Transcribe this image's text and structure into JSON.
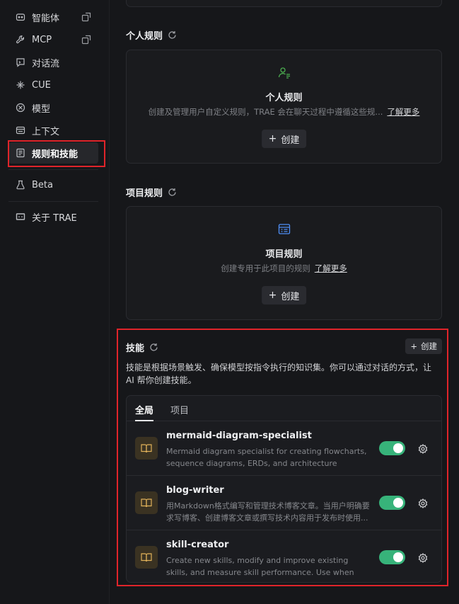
{
  "sidebar": {
    "items": [
      {
        "label": "智能体",
        "icon": "agent-icon",
        "external": true
      },
      {
        "label": "MCP",
        "icon": "wrench-icon",
        "external": true
      },
      {
        "label": "对话流",
        "icon": "chat-flow-icon"
      },
      {
        "label": "CUE",
        "icon": "cue-icon"
      },
      {
        "label": "模型",
        "icon": "model-icon"
      },
      {
        "label": "上下文",
        "icon": "context-icon"
      },
      {
        "label": "规则和技能",
        "icon": "rules-icon",
        "active": true
      }
    ],
    "beta": {
      "label": "Beta",
      "icon": "flask-icon"
    },
    "about": {
      "label": "关于 TRAE",
      "icon": "trae-logo-icon"
    }
  },
  "personal_rules": {
    "title": "个人规则",
    "card_title": "个人规则",
    "description": "创建及管理用户自定义规则，TRAE 会在聊天过程中遵循这些规...",
    "link": "了解更多",
    "button": "创建"
  },
  "project_rules": {
    "title": "项目规则",
    "card_title": "项目规则",
    "description": "创建专用于此项目的规则",
    "link": "了解更多",
    "button": "创建"
  },
  "skills": {
    "title": "技能",
    "create_button": "创建",
    "description": "技能是根据场景触发、确保模型按指令执行的知识集。你可以通过对话的方式，让 AI 帮你创建技能。",
    "tabs": [
      "全局",
      "项目"
    ],
    "items": [
      {
        "name": "mermaid-diagram-specialist",
        "description": "Mermaid diagram specialist for creating flowcharts, sequence diagrams, ERDs, and architecture visualizatio...",
        "enabled": true
      },
      {
        "name": "blog-writer",
        "description": "用Markdown格式编写和管理技术博客文章。当用户明确要求写博客、创建博客文章或撰写技术内容用于发布时使用...",
        "enabled": true
      },
      {
        "name": "skill-creator",
        "description": "Create new skills, modify and improve existing skills, and measure skill performance. Use when users want ...",
        "enabled": true
      }
    ]
  },
  "colors": {
    "background": "#16171a",
    "card": "#1a1b1e",
    "toggle_on": "#37b37a",
    "highlight_border": "#e0242a",
    "personal_icon": "#4caf50",
    "project_icon": "#4f8ff7",
    "skill_icon": "#e0b15a"
  }
}
